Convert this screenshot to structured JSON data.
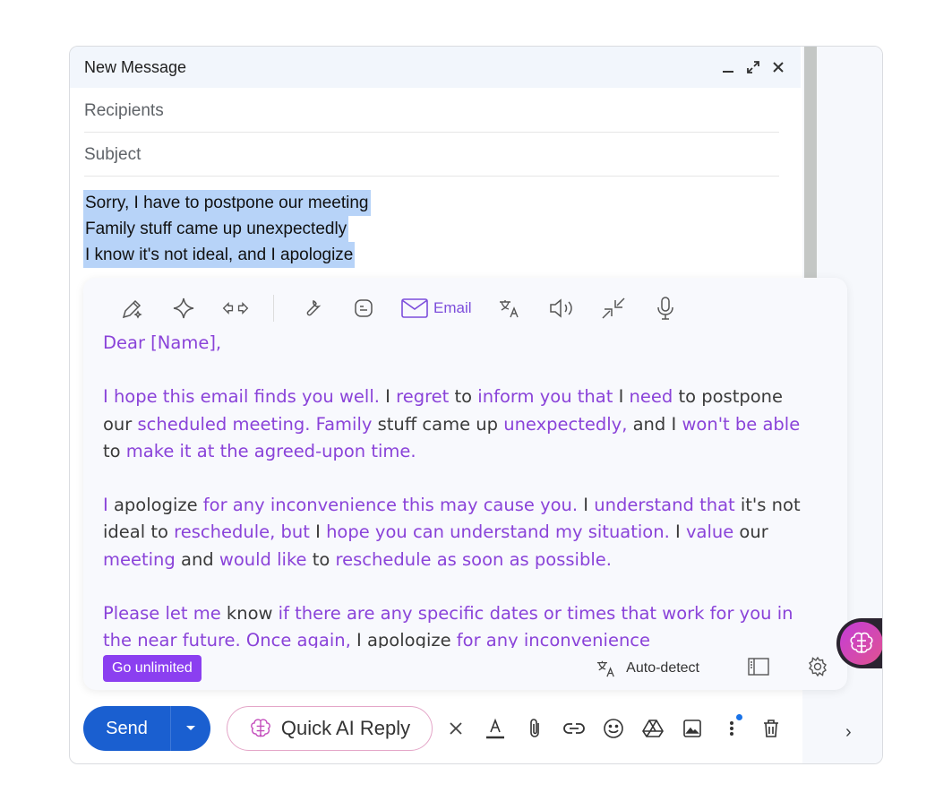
{
  "compose": {
    "title": "New Message",
    "recipients_placeholder": "Recipients",
    "subject_placeholder": "Subject",
    "body_lines": [
      "Sorry, I have to postpone our meeting",
      "Family stuff came up unexpectedly",
      "I know it's not ideal, and I apologize"
    ]
  },
  "ai_panel": {
    "toolbar": {
      "icons": [
        "pen-sparkle-icon",
        "sparkle-icon",
        "arrows-icon",
        "wrench-icon",
        "blog-icon",
        "email-icon",
        "translate-icon",
        "speaker-icon",
        "shrink-icon",
        "mic-icon"
      ],
      "email_label": "Email"
    },
    "output": {
      "greeting": "Dear [Name],",
      "paragraphs": [
        [
          {
            "t": "I hope this email finds you well. ",
            "h": true
          },
          {
            "t": "I ",
            "h": false
          },
          {
            "t": "regret",
            "h": true
          },
          {
            "t": " to ",
            "h": false
          },
          {
            "t": "inform you that",
            "h": true
          },
          {
            "t": " I ",
            "h": false
          },
          {
            "t": "need",
            "h": true
          },
          {
            "t": " to postpone our ",
            "h": false
          },
          {
            "t": "scheduled meeting. Family",
            "h": true
          },
          {
            "t": " stuff came up ",
            "h": false
          },
          {
            "t": "unexpectedly,",
            "h": true
          },
          {
            "t": " and I ",
            "h": false
          },
          {
            "t": "won't be able",
            "h": true
          },
          {
            "t": " to ",
            "h": false
          },
          {
            "t": "make it at the agreed-upon time.",
            "h": true
          }
        ],
        [
          {
            "t": "I",
            "h": true
          },
          {
            "t": " apologize ",
            "h": false
          },
          {
            "t": "for any inconvenience this may cause you.",
            "h": true
          },
          {
            "t": " I ",
            "h": false
          },
          {
            "t": "understand that",
            "h": true
          },
          {
            "t": " it's not ideal to ",
            "h": false
          },
          {
            "t": "reschedule, but",
            "h": true
          },
          {
            "t": " I ",
            "h": false
          },
          {
            "t": "hope you can understand my situation.",
            "h": true
          },
          {
            "t": " I ",
            "h": false
          },
          {
            "t": "value",
            "h": true
          },
          {
            "t": " our ",
            "h": false
          },
          {
            "t": "meeting",
            "h": true
          },
          {
            "t": " and ",
            "h": false
          },
          {
            "t": "would like",
            "h": true
          },
          {
            "t": " to ",
            "h": false
          },
          {
            "t": "reschedule as soon as possible.",
            "h": true
          }
        ],
        [
          {
            "t": "Please let me",
            "h": true
          },
          {
            "t": " know ",
            "h": false
          },
          {
            "t": "if there are any specific dates or times that work for you in the near future. Once again,",
            "h": true
          },
          {
            "t": " I apologize ",
            "h": false
          },
          {
            "t": "for any inconvenience",
            "h": true
          }
        ]
      ]
    },
    "footer": {
      "go_unlimited": "Go unlimited",
      "language": "Auto-detect"
    }
  },
  "bottom_bar": {
    "send_label": "Send",
    "quick_ai_label": "Quick AI Reply"
  },
  "colors": {
    "accent_purple": "#8a43d9",
    "send_blue": "#1a5fd0",
    "selection": "#b7d3f8"
  }
}
